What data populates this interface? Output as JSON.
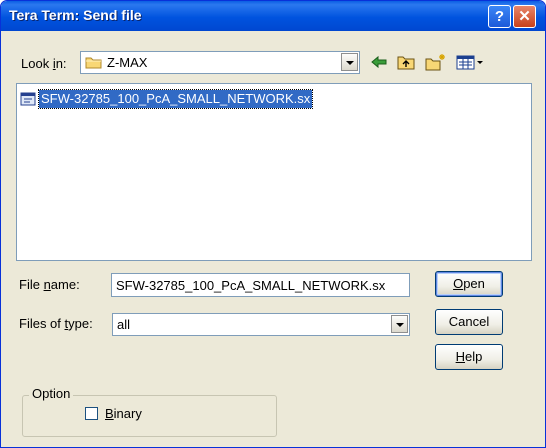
{
  "window": {
    "title": "Tera Term: Send file",
    "help_glyph": "?",
    "close_glyph": "✕"
  },
  "lookin": {
    "label_prefix": "Look ",
    "label_accel": "i",
    "label_suffix": "n:",
    "value": "Z-MAX"
  },
  "toolbar": {
    "back_icon": "back-arrow-icon",
    "up_icon": "up-folder-icon",
    "new_folder_icon": "new-folder-icon",
    "view_menu_icon": "view-menu-icon"
  },
  "files": [
    {
      "name": "SFW-32785_100_PcA_SMALL_NETWORK.sx",
      "selected": true
    }
  ],
  "filename": {
    "label_prefix": "File ",
    "label_accel": "n",
    "label_suffix": "ame:",
    "value": "SFW-32785_100_PcA_SMALL_NETWORK.sx"
  },
  "filetype": {
    "label_prefix": "Files of ",
    "label_accel": "t",
    "label_suffix": "ype:",
    "value": "all"
  },
  "buttons": {
    "open_accel": "O",
    "open_rest": "pen",
    "cancel": "Cancel",
    "help_accel": "H",
    "help_rest": "elp"
  },
  "option": {
    "group_label": "Option",
    "binary_accel": "B",
    "binary_rest": "inary",
    "binary_checked": false
  },
  "colors": {
    "title_bar": "#0053df",
    "selection": "#316ac5",
    "dialog_bg": "#ece9d8"
  }
}
